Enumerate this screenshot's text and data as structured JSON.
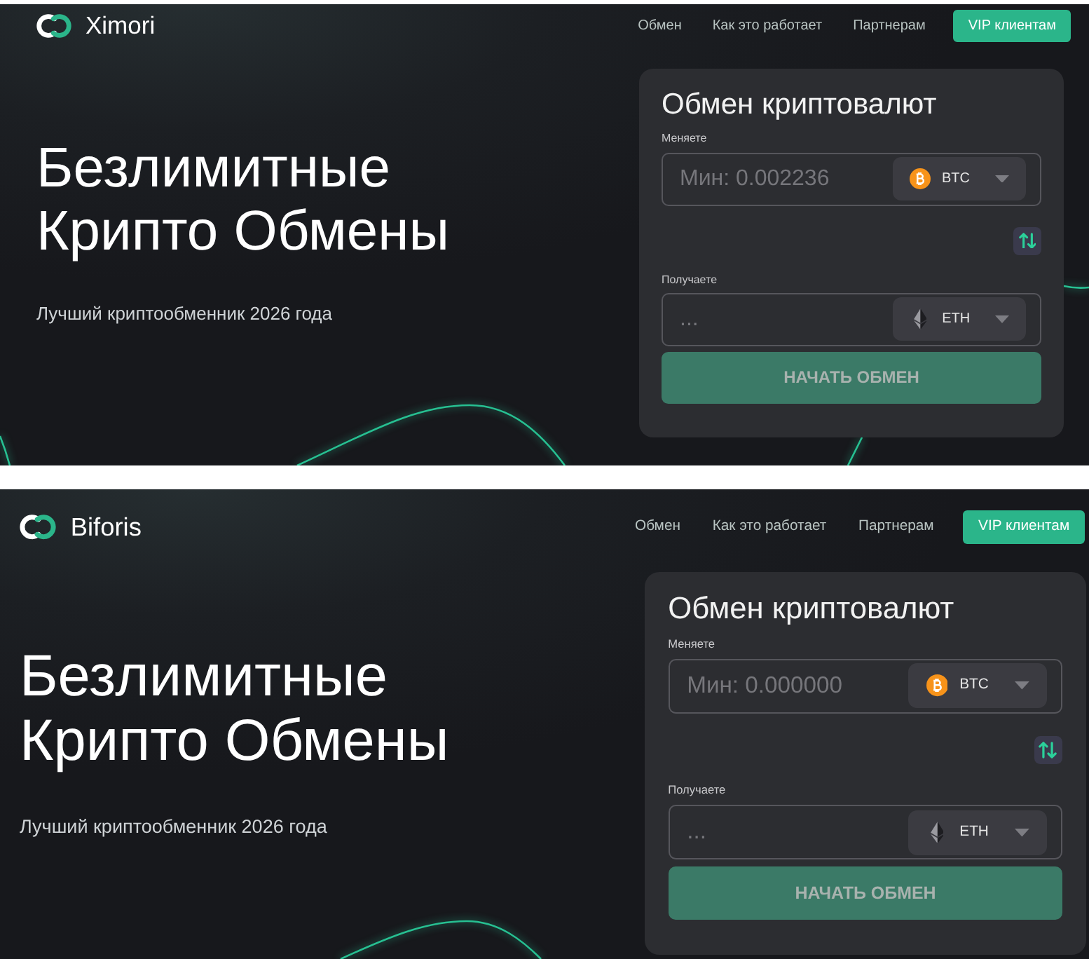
{
  "screenshots": [
    {
      "navbar": {
        "brand": "Ximori",
        "links": [
          "Обмен",
          "Как это работает",
          "Партнерам"
        ],
        "cta": "VIP клиентам"
      },
      "hero": {
        "title": "Безлимитные Крипто Обмены",
        "subtitle": "Лучший криптообменник 2026 года"
      },
      "exchange": {
        "title": "Обмен криптовалют",
        "fields": [
          {
            "label": "Меняете",
            "placeholder": "Мин: 0.002236",
            "currency": {
              "code": "BTC",
              "kind": "bitcoin"
            }
          },
          {
            "label": "Получаете",
            "placeholder": "...",
            "currency": {
              "code": "ETH",
              "kind": "ethereum"
            }
          }
        ],
        "submit": "НАЧАТЬ ОБМЕН"
      }
    },
    {
      "navbar": {
        "brand": "Biforis",
        "links": [
          "Обмен",
          "Как это работает",
          "Партнерам"
        ],
        "cta": "VIP клиентам"
      },
      "hero": {
        "title": "Безлимитные Крипто Обмены",
        "subtitle": "Лучший криптообменник 2026 года"
      },
      "exchange": {
        "title": "Обмен криптовалют",
        "fields": [
          {
            "label": "Меняете",
            "placeholder": "Мин: 0.000000",
            "currency": {
              "code": "BTC",
              "kind": "bitcoin"
            }
          },
          {
            "label": "Получаете",
            "placeholder": "...",
            "currency": {
              "code": "ETH",
              "kind": "ethereum"
            }
          }
        ],
        "submit": "НАЧАТЬ ОБМЕН"
      }
    }
  ]
}
